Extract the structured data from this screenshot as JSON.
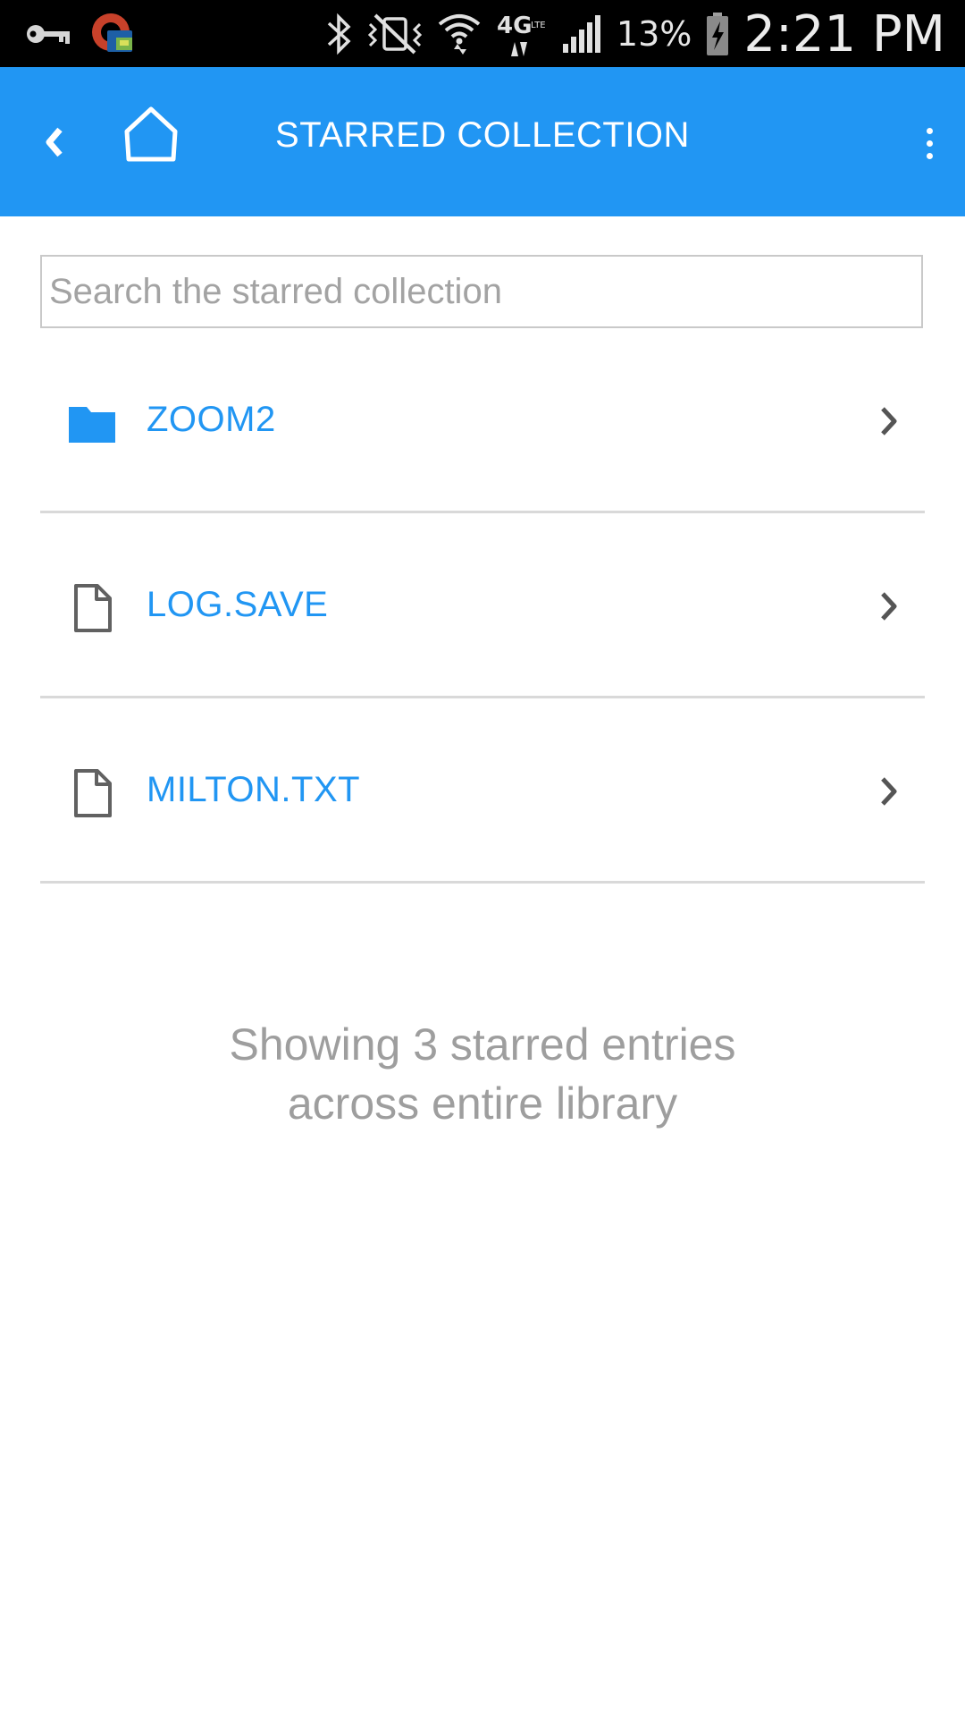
{
  "status_bar": {
    "battery_percent": "13%",
    "time": "2:21 PM",
    "network_label": "4G",
    "icons": [
      "key-icon",
      "app-notification-icon",
      "bluetooth-icon",
      "vibrate-icon",
      "wifi-icon",
      "4g-lte-icon",
      "signal-icon",
      "battery-charging-icon"
    ]
  },
  "app_bar": {
    "title": "STARRED COLLECTION",
    "back_icon": "chevron-left-icon",
    "home_icon": "home-icon",
    "menu_icon": "overflow-menu-icon",
    "color": "#2196f3"
  },
  "search": {
    "placeholder": "Search the starred collection",
    "value": ""
  },
  "items": [
    {
      "label": "ZOOM2",
      "icon": "folder-icon"
    },
    {
      "label": "LOG.SAVE",
      "icon": "file-icon"
    },
    {
      "label": "MILTON.TXT",
      "icon": "file-icon"
    }
  ],
  "footer": {
    "summary": "Showing 3 starred entries across entire library"
  }
}
